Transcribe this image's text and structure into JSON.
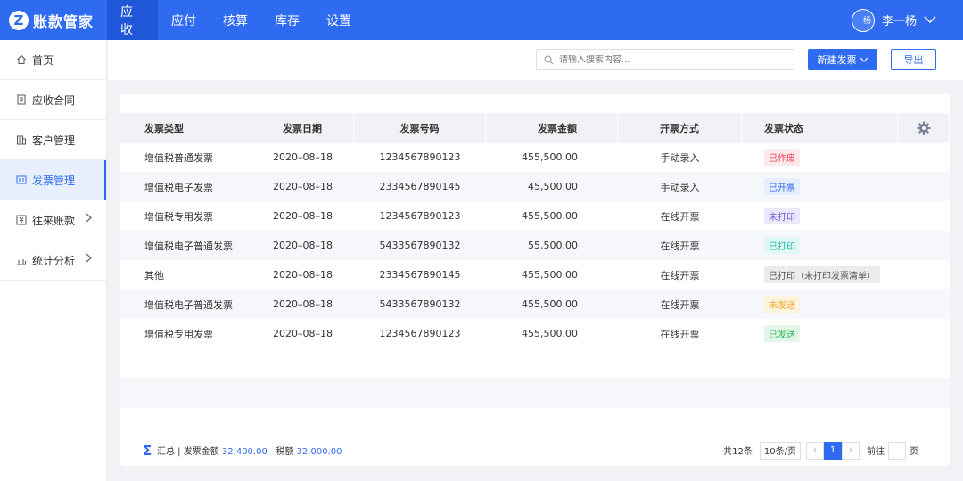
{
  "brand": {
    "letter": "Z",
    "name": "账款管家"
  },
  "topnav": [
    {
      "label": "应收"
    },
    {
      "label": "应付"
    },
    {
      "label": "核算"
    },
    {
      "label": "库存"
    },
    {
      "label": "设置"
    }
  ],
  "user": {
    "avatar_text": "一杨",
    "name": "李一杨"
  },
  "sidebar": [
    {
      "label": "首页",
      "icon": "home-icon"
    },
    {
      "label": "应收合同",
      "icon": "document-icon"
    },
    {
      "label": "客户管理",
      "icon": "building-icon"
    },
    {
      "label": "发票管理",
      "icon": "invoice-icon"
    },
    {
      "label": "往来账款",
      "icon": "yen-icon"
    },
    {
      "label": "统计分析",
      "icon": "chart-icon"
    }
  ],
  "toolbar": {
    "search_placeholder": "请输入搜索内容...",
    "new_invoice_label": "新建发票",
    "export_label": "导出"
  },
  "table": {
    "headers": [
      "发票类型",
      "发票日期",
      "发票号码",
      "发票金额",
      "开票方式",
      "发票状态"
    ],
    "rows": [
      {
        "type": "增值税普通发票",
        "date": "2020–08–18",
        "number": "1234567890123",
        "amount": "455,500.00",
        "method": "手动录入",
        "status": "已作废"
      },
      {
        "type": "增值税电子发票",
        "date": "2020–08–18",
        "number": "2334567890145",
        "amount": "45,500.00",
        "method": "手动录入",
        "status": "已开票"
      },
      {
        "type": "增值税专用发票",
        "date": "2020–08–18",
        "number": "1234567890123",
        "amount": "455,500.00",
        "method": "在线开票",
        "status": "未打印"
      },
      {
        "type": "增值税电子普通发票",
        "date": "2020–08–18",
        "number": "5433567890132",
        "amount": "55,500.00",
        "method": "在线开票",
        "status": "已打印"
      },
      {
        "type": "其他",
        "date": "2020–08–18",
        "number": "2334567890145",
        "amount": "455,500.00",
        "method": "在线开票",
        "status": "已打印（未打印发票清单）"
      },
      {
        "type": "增值税电子普通发票",
        "date": "2020–08–18",
        "number": "5433567890132",
        "amount": "455,500.00",
        "method": "在线开票",
        "status": "未发送"
      },
      {
        "type": "增值税专用发票",
        "date": "2020–08–18",
        "number": "1234567890123",
        "amount": "455,500.00",
        "method": "在线开票",
        "status": "已发送"
      }
    ],
    "status_colors": {
      "已作废": {
        "fg": "#f5455c",
        "bg": "#fde8eb"
      },
      "已开票": {
        "fg": "#2f6bf0",
        "bg": "#e6eeff"
      },
      "未打印": {
        "fg": "#6b5ce7",
        "bg": "#ebe8fc"
      },
      "已打印": {
        "fg": "#1fbfa5",
        "bg": "#e0f7f3"
      },
      "已打印（未打印发票清单）": {
        "fg": "#555555",
        "bg": "#ececec"
      },
      "未发送": {
        "fg": "#f5a623",
        "bg": "#fff4e0"
      },
      "已发送": {
        "fg": "#2eb85c",
        "bg": "#e3f6e9"
      }
    }
  },
  "summary": {
    "prefix": "汇总 | 发票金额",
    "invoice_amount": "32,400.00",
    "tax_label": "税额",
    "tax_amount": "32,000.00"
  },
  "pager": {
    "total": "共12条",
    "page_size": "10条/页",
    "current": "1",
    "goto_label": "前往",
    "page_suffix": "页"
  },
  "colors": {
    "primary": "#2f6bf0",
    "topbar": "#2f6bf0"
  }
}
